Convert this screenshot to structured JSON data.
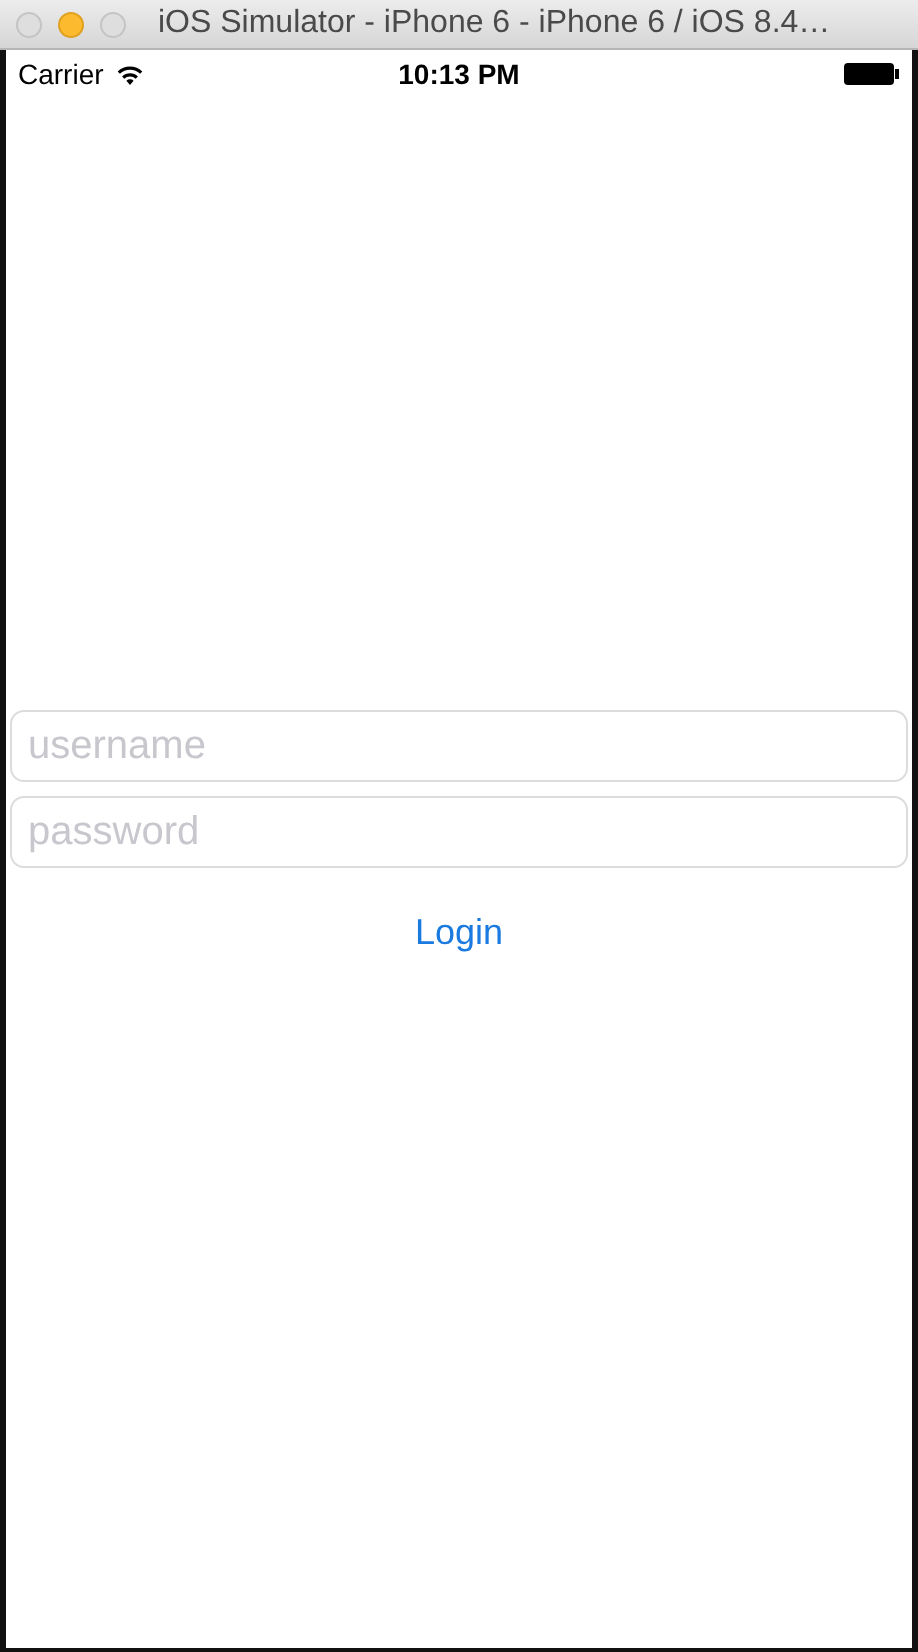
{
  "window": {
    "title": "iOS Simulator - iPhone 6 - iPhone 6 / iOS 8.4…"
  },
  "status_bar": {
    "carrier": "Carrier",
    "time": "10:13 PM"
  },
  "form": {
    "username": {
      "placeholder": "username"
    },
    "password": {
      "placeholder": "password"
    },
    "login_button": "Login"
  }
}
